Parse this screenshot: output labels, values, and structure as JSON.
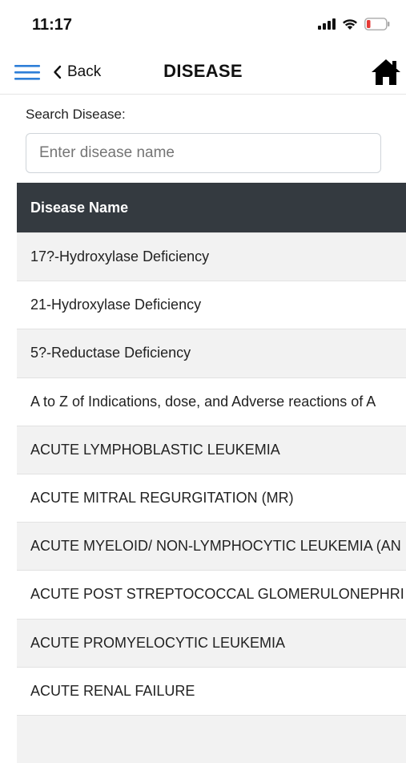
{
  "status_bar": {
    "time": "11:17",
    "battery_color": "#e53935"
  },
  "nav": {
    "back_label": "Back",
    "title": "DISEASE",
    "accent_color": "#2f7fd8"
  },
  "search": {
    "label": "Search Disease:",
    "placeholder": "Enter disease name",
    "value": ""
  },
  "table": {
    "header": "Disease Name",
    "rows": [
      "17?-Hydroxylase Deficiency",
      "21-Hydroxylase Deficiency",
      "5?-Reductase Deficiency",
      "A to Z of Indications, dose, and Adverse reactions of A",
      "ACUTE LYMPHOBLASTIC LEUKEMIA",
      "ACUTE MITRAL REGURGITATION (MR)",
      "ACUTE MYELOID/ NON-LYMPHOCYTIC LEUKEMIA (AN",
      "ACUTE POST STREPTOCOCCAL GLOMERULONEPHRI",
      "ACUTE PROMYELOCYTIC LEUKEMIA",
      "ACUTE RENAL FAILURE",
      ""
    ]
  }
}
